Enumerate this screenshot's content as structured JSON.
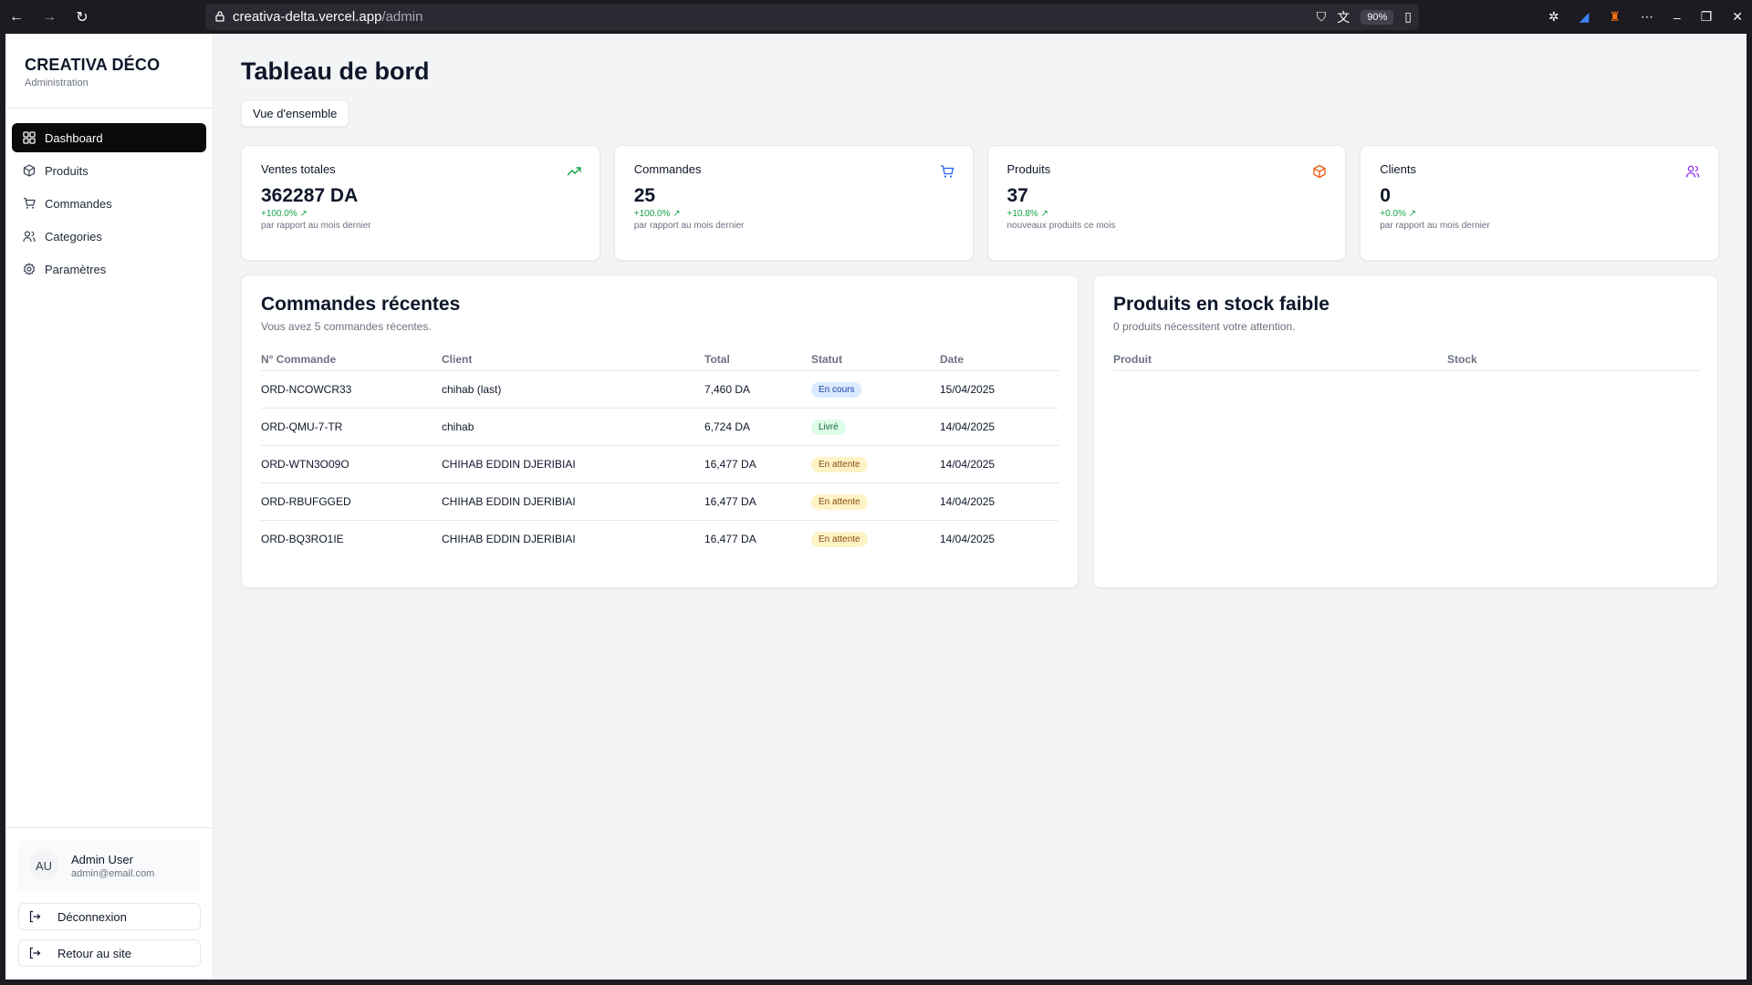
{
  "browser": {
    "url_host": "creativa-delta.vercel.app",
    "url_path": "/admin",
    "zoom": "90%"
  },
  "sidebar": {
    "brand_title": "CREATIVA DÉCO",
    "brand_sub": "Administration",
    "items": [
      {
        "label": "Dashboard",
        "icon": "grid-icon",
        "active": true
      },
      {
        "label": "Produits",
        "icon": "package-icon"
      },
      {
        "label": "Commandes",
        "icon": "cart-icon"
      },
      {
        "label": "Categories",
        "icon": "users-icon"
      },
      {
        "label": "Paramètres",
        "icon": "gear-icon"
      }
    ],
    "user": {
      "initials": "AU",
      "name": "Admin User",
      "email": "admin@email.com"
    },
    "logout_label": "Déconnexion",
    "back_label": "Retour au site"
  },
  "main": {
    "title": "Tableau de bord",
    "tab_label": "Vue d'ensemble",
    "stats": [
      {
        "label": "Ventes totales",
        "value": "362287 DA",
        "change": "+100.0% ↗",
        "note": "par rapport au mois dernier",
        "icon": "trending-up-icon",
        "icon_color": "#16a34a"
      },
      {
        "label": "Commandes",
        "value": "25",
        "change": "+100.0% ↗",
        "note": "par rapport au mois dernier",
        "icon": "cart-icon",
        "icon_color": "#2563eb"
      },
      {
        "label": "Produits",
        "value": "37",
        "change": "+10.8% ↗",
        "note": "nouveaux produits ce mois",
        "icon": "package-icon",
        "icon_color": "#ea580c"
      },
      {
        "label": "Clients",
        "value": "0",
        "change": "+0.0% ↗",
        "note": "par rapport au mois dernier",
        "icon": "users-icon",
        "icon_color": "#9333ea"
      }
    ],
    "orders": {
      "title": "Commandes récentes",
      "subtitle": "Vous avez 5 commandes récentes.",
      "columns": [
        "N° Commande",
        "Client",
        "Total",
        "Statut",
        "Date"
      ],
      "rows": [
        {
          "id": "ORD-NCOWCR33",
          "client": "chihab (last)",
          "total": "7,460 DA",
          "status": "En cours",
          "status_color": "blue",
          "date": "15/04/2025"
        },
        {
          "id": "ORD-QMU-7-TR",
          "client": "chihab",
          "total": "6,724 DA",
          "status": "Livré",
          "status_color": "green",
          "date": "14/04/2025"
        },
        {
          "id": "ORD-WTN3O09O",
          "client": "CHIHAB EDDIN DJERIBIAI",
          "total": "16,477 DA",
          "status": "En attente",
          "status_color": "yellow",
          "date": "14/04/2025"
        },
        {
          "id": "ORD-RBUFGGED",
          "client": "CHIHAB EDDIN DJERIBIAI",
          "total": "16,477 DA",
          "status": "En attente",
          "status_color": "yellow",
          "date": "14/04/2025"
        },
        {
          "id": "ORD-BQ3RO1IE",
          "client": "CHIHAB EDDIN DJERIBIAI",
          "total": "16,477 DA",
          "status": "En attente",
          "status_color": "yellow",
          "date": "14/04/2025"
        }
      ]
    },
    "stock": {
      "title": "Produits en stock faible",
      "subtitle": "0 produits nécessitent votre attention.",
      "columns": [
        "Produit",
        "Stock"
      ]
    }
  }
}
